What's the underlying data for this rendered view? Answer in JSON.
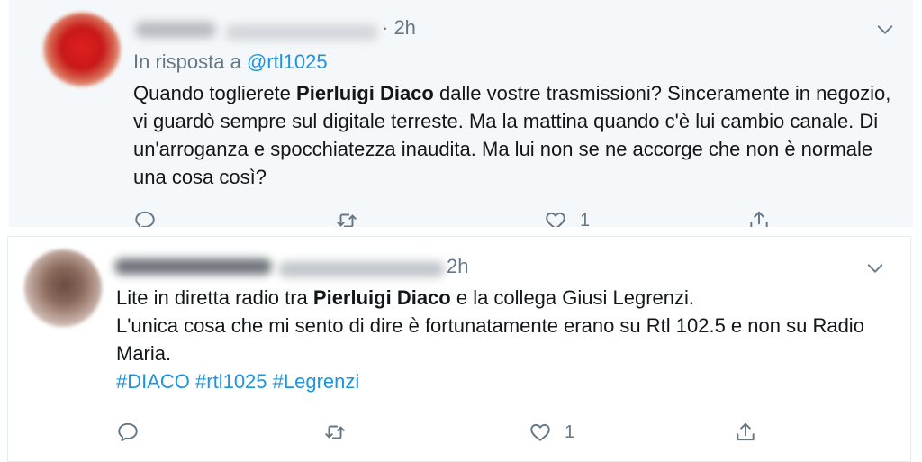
{
  "tweets": [
    {
      "time": "· 2h",
      "reply_prefix": "In risposta a",
      "reply_handle": "@rtl1025",
      "text_parts": {
        "before": "Quando toglierete ",
        "bold": "Pierluigi Diaco",
        "after": " dalle vostre trasmissioni? Sinceramente in negozio, vi guardò sempre sul digitale terreste. Ma la mattina quando c'è lui cambio canale. Di un'arroganza e spocchiatezza inaudita. Ma lui non se ne accorge che non è normale una cosa così?"
      },
      "likes": "1"
    },
    {
      "time": "2h",
      "text_parts": {
        "before": "Lite in diretta radio tra ",
        "bold": "Pierluigi Diaco",
        "after": " e la collega Giusi Legrenzi.",
        "line2": "L'unica cosa che mi sento di dire è fortunatamente erano su Rtl 102.5 e non su Radio Maria.",
        "hashtags": "#DIACO #rtl1025 #Legrenzi"
      },
      "likes": "1"
    }
  ],
  "icons": {
    "reply": "reply-icon",
    "retweet": "retweet-icon",
    "like": "heart-icon",
    "share": "share-icon",
    "more": "chevron-down-icon"
  },
  "colors": {
    "link": "#1b95e0",
    "muted": "#657786",
    "text": "#14171a",
    "highlight_bg": "#f5f8fa"
  }
}
